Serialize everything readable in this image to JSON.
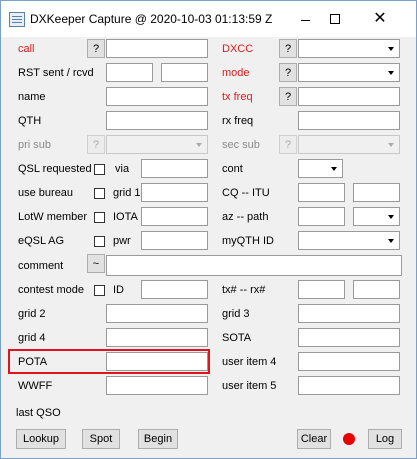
{
  "window": {
    "title": "DXKeeper Capture @ 2020-10-03   01:13:59 Z"
  },
  "labels": {
    "call": "call",
    "rst": "RST sent / rcvd",
    "name": "name",
    "qth": "QTH",
    "pri_sub": "pri sub",
    "qsl_requested": "QSL requested",
    "via": "via",
    "use_bureau": "use bureau",
    "grid1": "grid 1",
    "lotw_member": "LotW member",
    "iota": "IOTA",
    "eqsl_ag": "eQSL AG",
    "pwr": "pwr",
    "comment": "comment",
    "contest_mode": "contest mode",
    "id": "ID",
    "grid2": "grid 2",
    "grid4": "grid 4",
    "pota": "POTA",
    "wwff": "WWFF",
    "dxcc": "DXCC",
    "mode": "mode",
    "tx_freq": "tx freq",
    "rx_freq": "rx freq",
    "sec_sub": "sec sub",
    "cont": "cont",
    "cq_itu": "CQ  --  ITU",
    "az_path": "az  --  path",
    "myqth_id": "myQTH ID",
    "tx_rx_num": "tx#  --  rx#",
    "grid3": "grid 3",
    "sota": "SOTA",
    "user_item4": "user item 4",
    "user_item5": "user item 5",
    "last_qso": "last QSO"
  },
  "buttons": {
    "question": "?",
    "tilde": "~",
    "lookup": "Lookup",
    "spot": "Spot",
    "begin": "Begin",
    "clear": "Clear",
    "log": "Log"
  },
  "fields": {
    "call": "",
    "rst_sent": "",
    "rst_rcvd": "",
    "name": "",
    "qth": "",
    "via": "",
    "grid1": "",
    "iota": "",
    "pwr": "",
    "comment": "",
    "id": "",
    "grid2": "",
    "grid4": "",
    "pota": "",
    "wwff": "",
    "rx_freq": "",
    "cq": "",
    "itu": "",
    "az": "",
    "tx_num": "",
    "rx_num": "",
    "grid3": "",
    "sota": "",
    "user_item4": "",
    "user_item5": ""
  },
  "colors": {
    "label_red": "#d42020",
    "highlight": "#e0141e",
    "record": "#e80000"
  }
}
